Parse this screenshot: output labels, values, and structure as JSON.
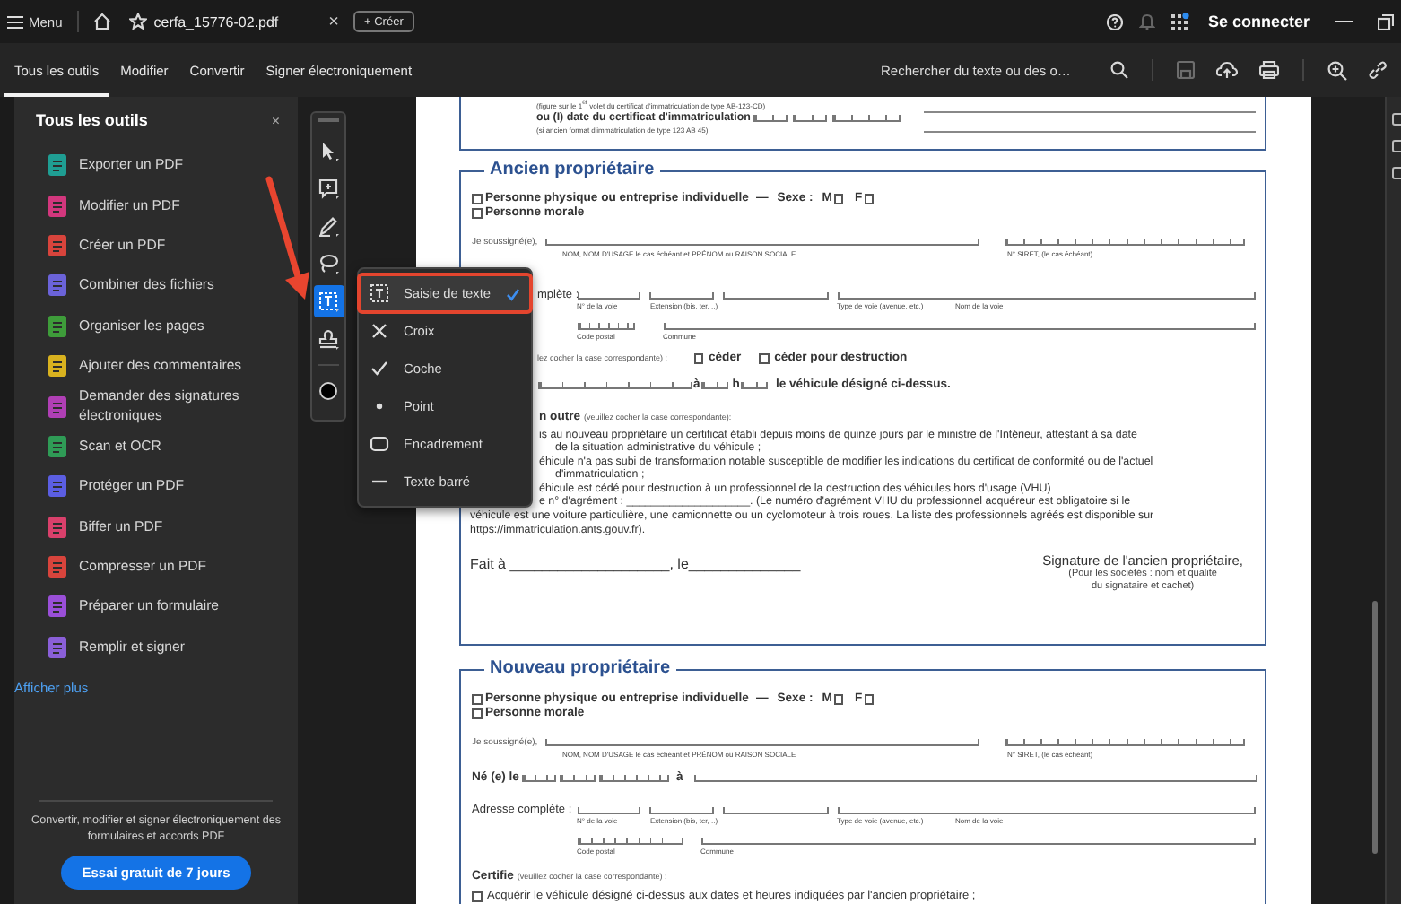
{
  "title_bar": {
    "menu": "Menu",
    "document_tab": "cerfa_15776-02.pdf",
    "close_tab": "×",
    "create": "+ Créer",
    "sign_in": "Se connecter"
  },
  "toolbar": {
    "tabs": [
      {
        "label": "Tous les outils",
        "selected": true
      },
      {
        "label": "Modifier",
        "selected": false
      },
      {
        "label": "Convertir",
        "selected": false
      },
      {
        "label": "Signer électroniquement",
        "selected": false
      }
    ],
    "search": {
      "placeholder": "Rechercher du texte ou des o…"
    }
  },
  "sidebar": {
    "title": "Tous les outils",
    "close": "×",
    "tools": [
      {
        "label": "Exporter un PDF",
        "color": "#1f9e93"
      },
      {
        "label": "Modifier un PDF",
        "color": "#d2377d"
      },
      {
        "label": "Créer un PDF",
        "color": "#d8443c"
      },
      {
        "label": "Combiner des fichiers",
        "color": "#6b63d9"
      },
      {
        "label": "Organiser les pages",
        "color": "#3e9c3a"
      },
      {
        "label": "Ajouter des commentaires",
        "color": "#d9b21f"
      },
      {
        "label": "Demander des signatures électroniques",
        "color": "#b03fb5"
      },
      {
        "label": "Scan et OCR",
        "color": "#2f9b56"
      },
      {
        "label": "Protéger un PDF",
        "color": "#5b5ee2"
      },
      {
        "label": "Biffer un PDF",
        "color": "#d9406b"
      },
      {
        "label": "Compresser un PDF",
        "color": "#d8443c"
      },
      {
        "label": "Préparer un formulaire",
        "color": "#9a4fd8"
      },
      {
        "label": "Remplir et signer",
        "color": "#8a5fd8"
      }
    ],
    "show_more": "Afficher plus",
    "promo": "Convertir, modifier et signer électroniquement des formulaires et accords PDF",
    "trial_button": "Essai gratuit de 7 jours"
  },
  "annotation_rail": {
    "tools": [
      {
        "kind": "select",
        "selected": false
      },
      {
        "kind": "comment",
        "selected": false
      },
      {
        "kind": "pen",
        "selected": false
      },
      {
        "kind": "lasso",
        "selected": false
      },
      {
        "kind": "text",
        "selected": true
      },
      {
        "kind": "stamp",
        "selected": false
      },
      {
        "kind": "color",
        "selected": false
      }
    ]
  },
  "markup_menu": {
    "items": [
      {
        "kind": "text",
        "label": "Saisie de texte",
        "selected": true
      },
      {
        "kind": "cross",
        "label": "Croix",
        "selected": false
      },
      {
        "kind": "check",
        "label": "Coche",
        "selected": false
      },
      {
        "kind": "dot",
        "label": "Point",
        "selected": false
      },
      {
        "kind": "frame",
        "label": "Encadrement",
        "selected": false
      },
      {
        "kind": "strike",
        "label": "Texte barré",
        "selected": false
      }
    ]
  },
  "document": {
    "certificate_box": {
      "note": "(figure sur le 1$^{er}$ volet du certificat d'immatriculation de type AB-123-CD)",
      "date_label": "ou (I) date du certificat d'immatriculation",
      "format_note": "(si ancien format d'immatriculation de type 123 AB 45)"
    },
    "former_owner": {
      "title": "Ancien propriétaire",
      "person_types": [
        {
          "label": "Personne physique ou entreprise individuelle",
          "checked": false
        },
        {
          "label": "Personne morale",
          "checked": false
        }
      ],
      "sex": {
        "dash": "—",
        "label": "Sexe :",
        "options": [
          {
            "label": "M",
            "checked": false
          },
          {
            "label": "F",
            "checked": false
          }
        ]
      },
      "undersigned": "Je soussigné(e),",
      "name_caption": "NOM, NOM D'USAGE le cas échéant et PRÉNOM ou RAISON SOCIALE",
      "siret_caption": "N° SIRET, (le cas échéant)",
      "address_label": "mplète :",
      "address_captions": [
        "N° de la voie",
        "Extension (bis, ter, ..)",
        "Type de voie (avenue, etc.)",
        "Nom de la voie"
      ],
      "postal_captions": [
        "Code postal",
        "Commune"
      ],
      "choice_hint": "lez cocher la case correspondante) :",
      "choices": [
        {
          "label": "céder",
          "checked": false
        },
        {
          "label": "céder pour destruction",
          "checked": false
        }
      ],
      "time_at": "à",
      "time_hour": "h",
      "time_text": "le véhicule désigné ci-dessus.",
      "also_label": "n outre",
      "also_hint": "(veuillez cocher la case correspondante):",
      "lines": [
        {
          "kind": "item",
          "text": "is au nouveau propriétaire un certificat établi depuis moins de quinze jours par le ministre de l'Intérieur, attestant à sa date"
        },
        {
          "kind": "wrap",
          "text": "de la situation administrative du véhicule ;"
        },
        {
          "kind": "item",
          "text": "éhicule n'a pas subi de transformation notable susceptible de modifier les indications du certificat de conformité ou de l'actuel"
        },
        {
          "kind": "wrap",
          "text": "d'immatriculation ;"
        },
        {
          "kind": "item",
          "text": "éhicule est cédé pour destruction à un professionnel de la destruction des véhicules hors d'usage (VHU)"
        },
        {
          "kind": "item",
          "text": "e n° d'agrément : ____________________. (Le numéro d'agrément VHU du professionnel acquéreur est obligatoire si le"
        },
        {
          "kind": "note",
          "text": "véhicule est une voiture particulière, une camionnette ou un cyclomoteur à trois roues. La liste des professionnels agréés est disponible sur"
        },
        {
          "kind": "note",
          "text": "https://immatriculation.ants.gouv.fr)."
        }
      ],
      "place_date": "Fait à ____________________, le______________",
      "signature": [
        "Signature de l'ancien propriétaire,",
        "(Pour les sociétés : nom et qualité",
        "du signataire et cachet)"
      ]
    },
    "new_owner": {
      "title": "Nouveau propriétaire",
      "person_types": [
        {
          "label": "Personne physique ou entreprise individuelle",
          "checked": false
        },
        {
          "label": "Personne morale",
          "checked": false
        }
      ],
      "sex": {
        "dash": "—",
        "label": "Sexe :",
        "options": [
          {
            "label": "M",
            "checked": false
          },
          {
            "label": "F",
            "checked": false
          }
        ]
      },
      "undersigned": "Je soussigné(e),",
      "name_caption": "NOM, NOM D'USAGE le cas échéant et PRÉNOM ou RAISON SOCIALE",
      "siret_caption": "N° SIRET, (le cas échéant)",
      "birth_label": "Né (e) le",
      "birth_at": "à",
      "address_label": "Adresse complète :",
      "address_captions": [
        "N° de la voie",
        "Extension (bis, ter, ..)",
        "Type de voie (avenue, etc.)",
        "Nom de la voie"
      ],
      "postal_captions": [
        "Code postal",
        "Commune"
      ],
      "certify_label": "Certifie",
      "certify_hint": "(veuillez cocher la case correspondante) :",
      "options": [
        {
          "label": "Acquérir le véhicule désigné ci-dessus aux dates et heures indiquées par l'ancien propriétaire ;",
          "checked": false
        }
      ]
    }
  }
}
